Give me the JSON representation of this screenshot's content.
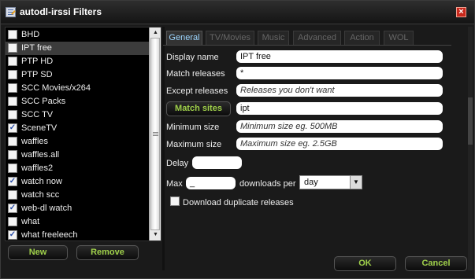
{
  "window": {
    "title": "autodl-irssi Filters",
    "close_glyph": "×"
  },
  "filter_list": {
    "items": [
      {
        "label": "BHD",
        "checked": false,
        "selected": false
      },
      {
        "label": "IPT free",
        "checked": false,
        "selected": true
      },
      {
        "label": "PTP HD",
        "checked": false,
        "selected": false
      },
      {
        "label": "PTP SD",
        "checked": false,
        "selected": false
      },
      {
        "label": "SCC Movies/x264",
        "checked": false,
        "selected": false
      },
      {
        "label": "SCC Packs",
        "checked": false,
        "selected": false
      },
      {
        "label": "SCC TV",
        "checked": false,
        "selected": false
      },
      {
        "label": "SceneTV",
        "checked": true,
        "selected": false
      },
      {
        "label": "waffles",
        "checked": false,
        "selected": false
      },
      {
        "label": "waffles.all",
        "checked": false,
        "selected": false
      },
      {
        "label": "waffles2",
        "checked": false,
        "selected": false
      },
      {
        "label": "watch now",
        "checked": true,
        "selected": false
      },
      {
        "label": "watch scc",
        "checked": false,
        "selected": false
      },
      {
        "label": "web-dl watch",
        "checked": true,
        "selected": false
      },
      {
        "label": "what",
        "checked": false,
        "selected": false
      },
      {
        "label": "what freeleech",
        "checked": true,
        "selected": false
      }
    ],
    "new_label": "New",
    "remove_label": "Remove"
  },
  "tabs": [
    {
      "label": "General",
      "active": true
    },
    {
      "label": "TV/Movies",
      "active": false
    },
    {
      "label": "Music",
      "active": false
    },
    {
      "label": "Advanced",
      "active": false
    },
    {
      "label": "Action",
      "active": false
    },
    {
      "label": "WOL",
      "active": false
    }
  ],
  "general": {
    "display_name": {
      "label": "Display name",
      "value": "IPT free"
    },
    "match_releases": {
      "label": "Match releases",
      "value": "*"
    },
    "except_releases": {
      "label": "Except releases",
      "placeholder": "Releases you don't want"
    },
    "match_sites": {
      "button_label": "Match sites",
      "value": "ipt"
    },
    "minimum_size": {
      "label": "Minimum size",
      "placeholder": "Minimum size eg. 500MB"
    },
    "maximum_size": {
      "label": "Maximum size",
      "placeholder": "Maximum size eg. 2.5GB"
    },
    "delay": {
      "label": "Delay",
      "value": ""
    },
    "max": {
      "label": "Max",
      "value": "_",
      "per_label": "downloads per",
      "period_value": "day"
    },
    "download_duplicates": {
      "label": "Download duplicate releases",
      "checked": false
    }
  },
  "footer": {
    "ok_label": "OK",
    "cancel_label": "Cancel"
  },
  "colors": {
    "accent_green": "#9fd04a",
    "active_tab_text": "#9dd6ff",
    "close_red": "#c8281c"
  }
}
